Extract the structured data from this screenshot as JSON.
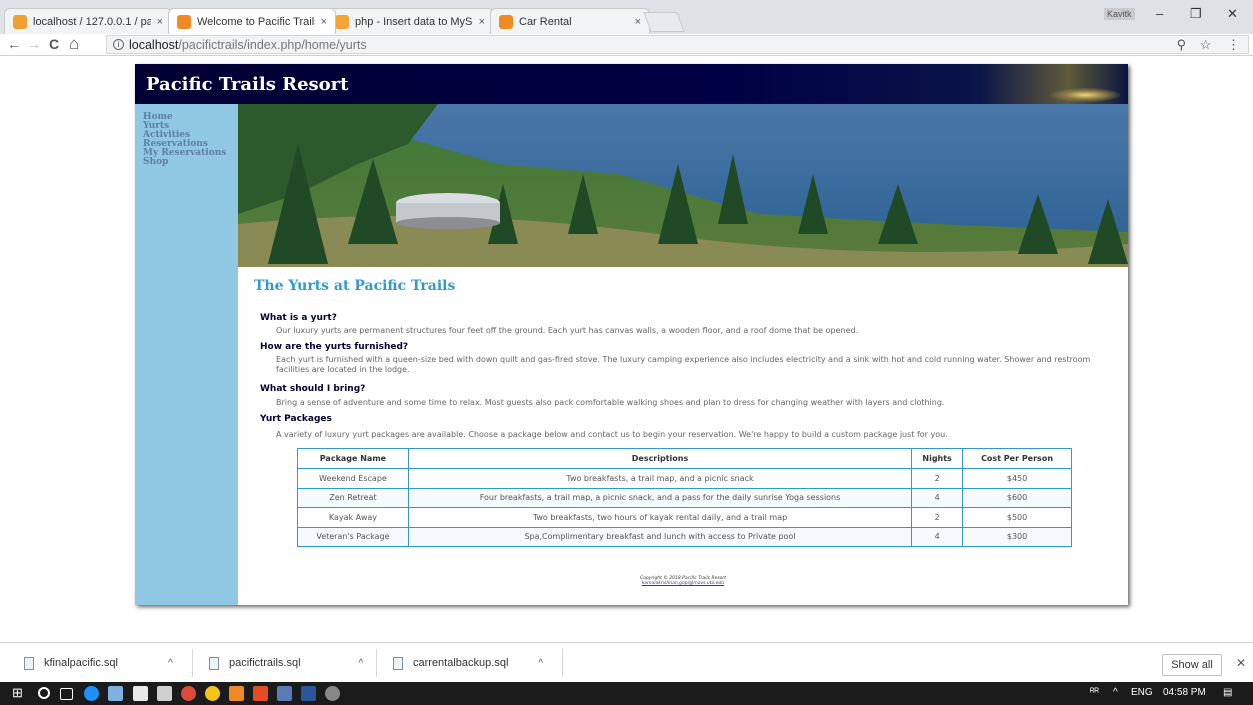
{
  "browser": {
    "tabs": [
      {
        "title": "localhost / 127.0.0.1 / pa",
        "favicon_color": "#f0a030"
      },
      {
        "title": "Welcome to Pacific Trails",
        "favicon_color": "#f08a24",
        "active": true
      },
      {
        "title": "php - Insert data to MySc",
        "favicon_color": "#f4a336"
      },
      {
        "title": "Car Rental",
        "favicon_color": "#f08a24"
      }
    ],
    "tab_close": "×",
    "user_badge": "Kavitk",
    "window_controls": {
      "minimize": "–",
      "restore": "❐",
      "close": "✕"
    },
    "nav": {
      "back": "←",
      "forward": "→",
      "reload": "C",
      "home": "⌂"
    },
    "url_host": "localhost",
    "url_path": "/pacifictrails/index.php/home/yurts",
    "info_icon_text": "i",
    "zoom_icon": "⚲",
    "star_icon": "☆",
    "menu_icon": "⋮"
  },
  "site": {
    "title": "Pacific Trails Resort",
    "nav": [
      "Home",
      "Yurts",
      "Activities",
      "Reservations",
      "My Reservations",
      "Shop"
    ],
    "heading": "The Yurts at Pacific Trails",
    "faq": [
      {
        "q": "What is a yurt?",
        "a": "Our luxury yurts are permanent structures four feet off the ground. Each yurt has canvas walls, a wooden floor, and a roof dome that be opened."
      },
      {
        "q": "How are the yurts furnished?",
        "a": "Each yurt is furnished with a queen-size bed with down quilt and gas-fired stove. The luxury camping experience also includes electricity and a sink with hot and cold running water. Shower and restroom facilities are located in the lodge."
      },
      {
        "q": "What should I bring?",
        "a": "Bring a sense of adventure and some time to relax. Most guests also pack comfortable walking shoes and plan to dress for changing weather with layers and clothing."
      },
      {
        "q": "Yurt Packages",
        "a": "A variety of luxury yurt packages are available. Choose a package below and contact us to begin your reservation. We're happy to build a custom package just for you."
      }
    ],
    "table": {
      "headers": [
        "Package Name",
        "Descriptions",
        "Nights",
        "Cost Per Person"
      ],
      "rows": [
        [
          "Weekend Escape",
          "Two breakfasts, a trail map, and a picnic snack",
          "2",
          "$450"
        ],
        [
          "Zen Retreat",
          "Four breakfasts, a trail map, a picnic snack, and a pass for the daily sunrise Yoga sessions",
          "4",
          "$600"
        ],
        [
          "Kayak Away",
          "Two breakfasts, two hours of kayak rental daily, and a trail map",
          "2",
          "$500"
        ],
        [
          "Veteran's Package",
          "Spa,Complimentary breakfast and lunch with access to Private pool",
          "4",
          "$300"
        ]
      ]
    },
    "footer_copyright": "Copyright © 2018 Pacific Trails Resort",
    "footer_email": "kamalakrishnan.gopi@mavs.uta.edu"
  },
  "downloads": {
    "items": [
      "kfinalpacific.sql",
      "pacifictrails.sql",
      "carrentalbackup.sql"
    ],
    "chevron": "^",
    "show_all": "Show all",
    "close": "✕"
  },
  "taskbar": {
    "start_icon": "⊞",
    "tray_people": "ᴿᴿ",
    "tray_chevron": "^",
    "language": "ENG",
    "time": "04:58 PM",
    "notification_icon": "▤"
  },
  "colors": {
    "header_bg": "#000033",
    "nav_bg": "#90c7e3",
    "heading": "#3399cc",
    "question": "#000033",
    "table_border": "#3399cc"
  }
}
